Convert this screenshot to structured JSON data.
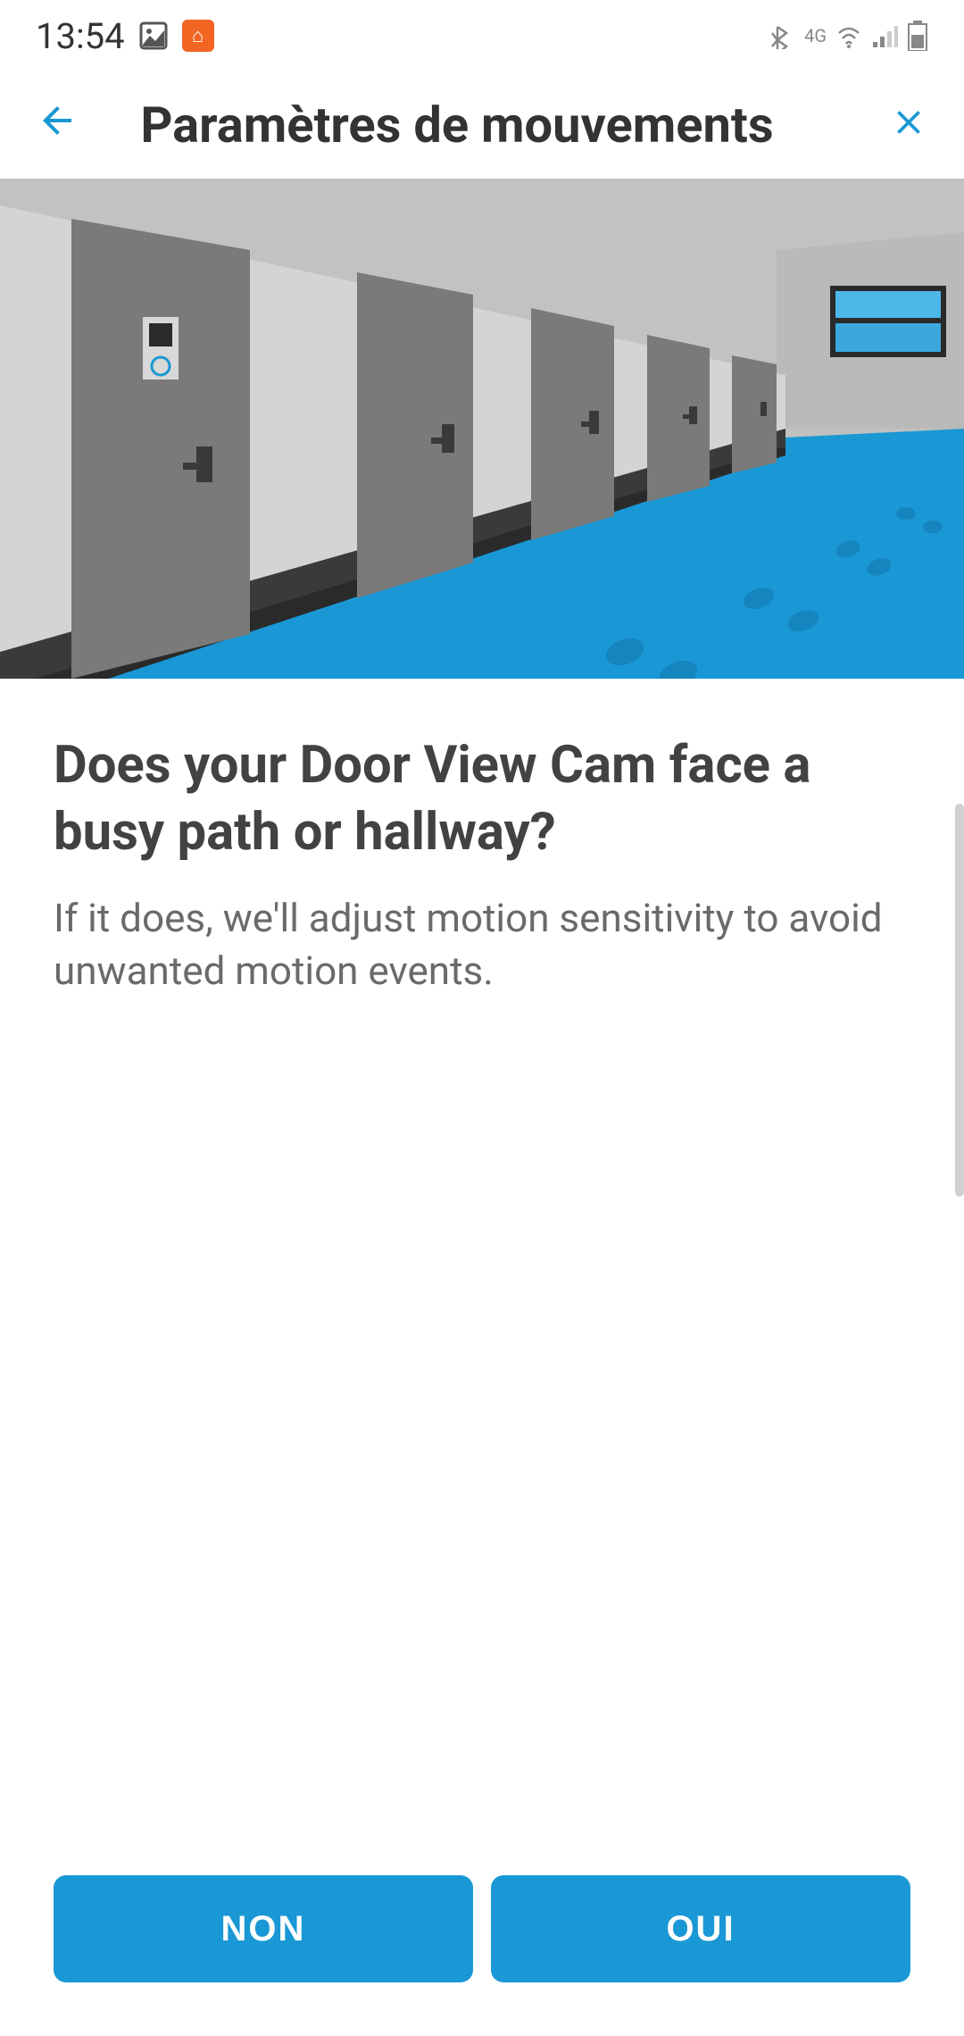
{
  "status_bar": {
    "time": "13:54"
  },
  "header": {
    "title": "Paramètres de mouvements"
  },
  "content": {
    "question": "Does your Door View Cam face a busy path or hallway?",
    "description": "If it does, we'll adjust motion sensitivity to avoid unwanted motion events."
  },
  "buttons": {
    "no": "NON",
    "yes": "OUI"
  },
  "colors": {
    "accent": "#1998d5"
  }
}
